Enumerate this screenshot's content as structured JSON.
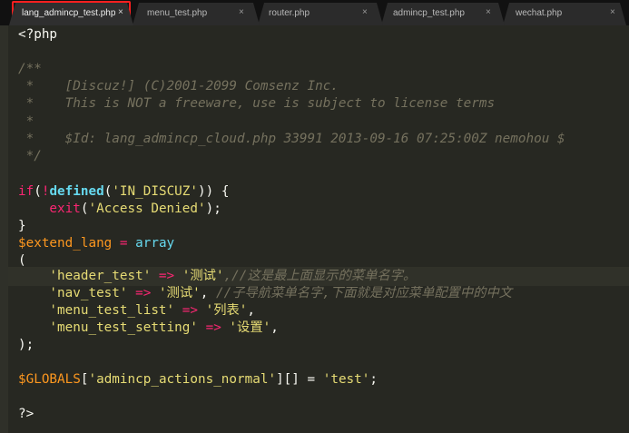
{
  "tabs": [
    {
      "label": "lang_admincp_test.php",
      "close": "×"
    },
    {
      "label": "menu_test.php",
      "close": "×"
    },
    {
      "label": "router.php",
      "close": "×"
    },
    {
      "label": "admincp_test.php",
      "close": "×"
    },
    {
      "label": "wechat.php",
      "close": "×"
    }
  ],
  "code": {
    "open": "<?php",
    "c1": "/**",
    "c2": " *    [Discuz!] (C)2001-2099 Comsenz Inc.",
    "c3": " *    This is NOT a freeware, use is subject to license terms",
    "c4": " *",
    "c5": " *    $Id: lang_admincp_cloud.php 33991 2013-09-16 07:25:00Z nemohou $",
    "c6": " */",
    "if_kw": "if",
    "if_p1": "(",
    "if_not": "!",
    "if_fn": "defined",
    "if_p2": "(",
    "if_str": "'IN_DISCUZ'",
    "if_p3": ")) {",
    "exit_fn": "    exit",
    "exit_p1": "(",
    "exit_str": "'Access Denied'",
    "exit_p2": ");",
    "close_brace": "}",
    "var_ext": "$extend_lang",
    "assign": " = ",
    "arr": "array",
    "open_paren": "(",
    "k1": "    'header_test'",
    "op1": " => ",
    "v1": "'测试'",
    "cm1": ",//这是最上面显示的菜单名字。",
    "k2": "    'nav_test'",
    "op2": " => ",
    "v2": "'测试'",
    "p2": ", ",
    "cm2": "//子导航菜单名字,下面就是对应菜单配置中的中文",
    "k3": "    'menu_test_list'",
    "op3": " => ",
    "v3": "'列表'",
    "p3": ",",
    "k4": "    'menu_test_setting'",
    "op4": " => ",
    "v4": "'设置'",
    "p4": ",",
    "end_arr": ");",
    "g_var": "$GLOBALS",
    "g_b1": "[",
    "g_key": "'admincp_actions_normal'",
    "g_b2": "][] = ",
    "g_val": "'test'",
    "g_end": ";",
    "close_tag": "?>"
  }
}
